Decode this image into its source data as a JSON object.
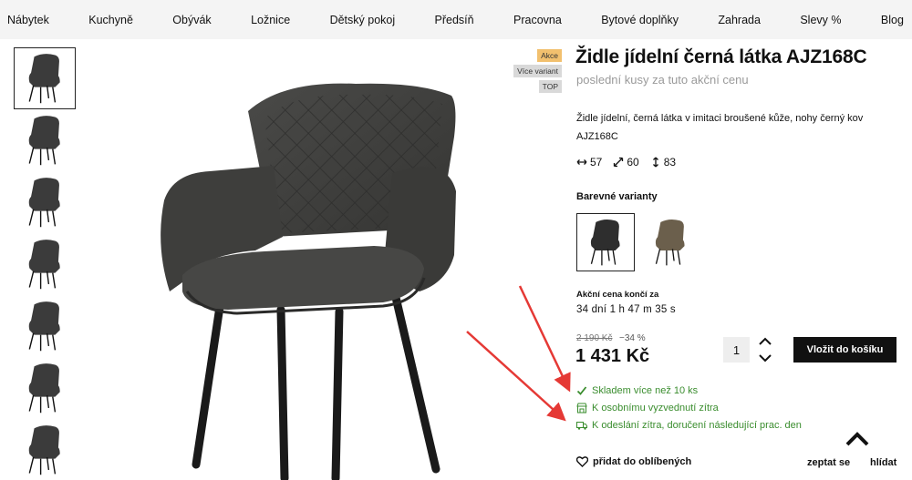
{
  "nav": {
    "items": [
      "Nábytek",
      "Kuchyně",
      "Obývák",
      "Ložnice",
      "Dětský pokoj",
      "Předsíň",
      "Pracovna",
      "Bytové doplňky",
      "Zahrada",
      "Slevy %",
      "Blog"
    ]
  },
  "badges": [
    "Akce",
    "Více variant",
    "TOP"
  ],
  "product": {
    "title": "Židle jídelní černá látka AJZ168C",
    "subtitle": "poslední kusy za tuto akční cenu",
    "description": "Židle jídelní, černá látka v imitaci broušené kůže, nohy černý kov AJZ168C",
    "dimensions": {
      "width": "57",
      "depth": "60",
      "height": "83"
    }
  },
  "variants": {
    "label": "Barevné varianty",
    "items": [
      {
        "color": "#2e2e2e"
      },
      {
        "color": "#6b5f4c"
      }
    ]
  },
  "countdown": {
    "label": "Akční cena končí za",
    "value": "34 dní 1 h 47 m 35 s"
  },
  "pricing": {
    "old_price": "2 190 Kč",
    "discount": "−34 %",
    "price": "1 431 Kč",
    "quantity": "1",
    "cart_button": "Vložit do košíku"
  },
  "stock": {
    "in_stock": "Skladem více než 10 ks",
    "pickup": "K osobnímu vyzvednutí zítra",
    "shipping": "K odeslání zítra, doručení následující prac. den"
  },
  "actions": {
    "wishlist": "přidat do oblíbených",
    "ask": "zeptat se",
    "watch": "hlídat"
  },
  "colors": {
    "accent_green": "#3a8d2e",
    "badge_sale": "#f2c06e",
    "arrow_red": "#e53935"
  },
  "icons": [
    "width-arrow-icon",
    "depth-arrow-icon",
    "height-arrow-icon",
    "check-icon",
    "store-icon",
    "truck-icon",
    "heart-icon",
    "chevron-up-icon",
    "chevron-down-icon"
  ]
}
